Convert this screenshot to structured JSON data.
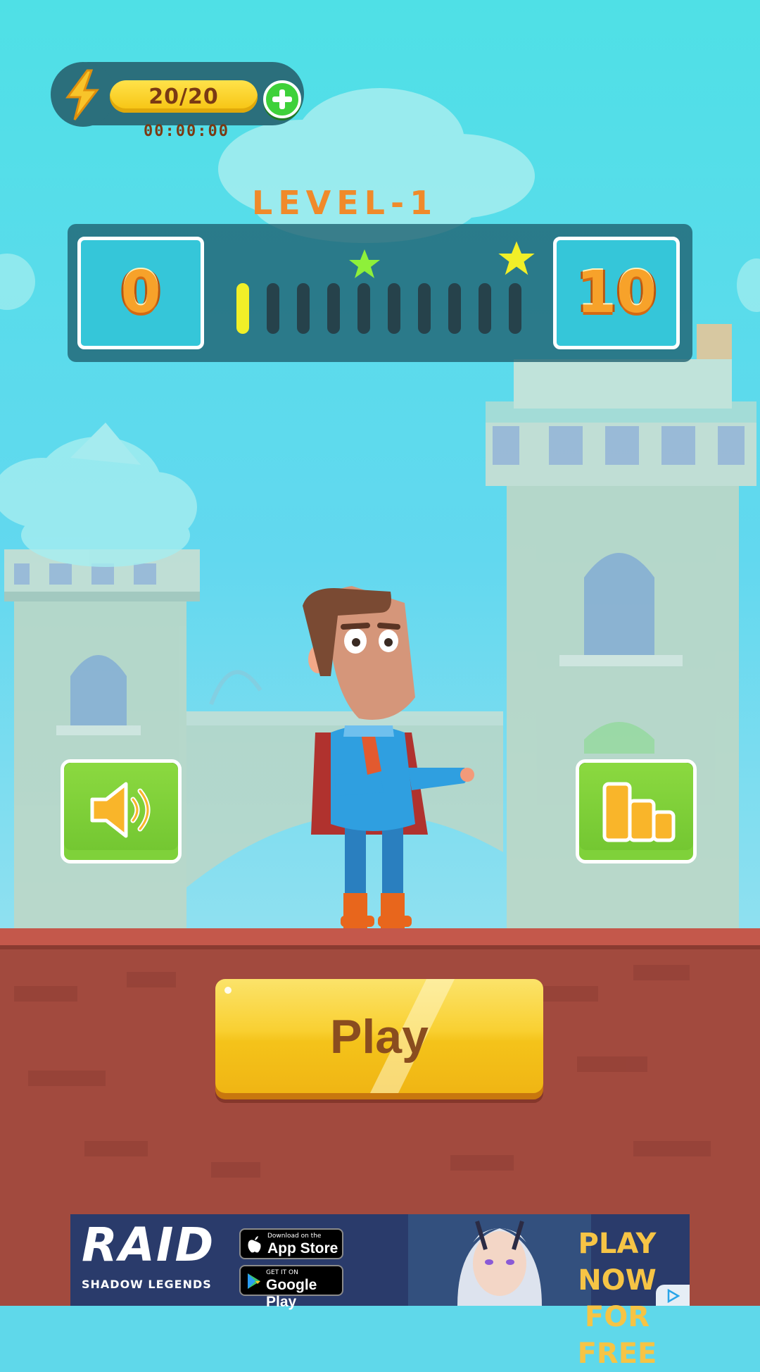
{
  "energy": {
    "value": "20/20",
    "timer": "00:00:00"
  },
  "level": {
    "title": "LEVEL-1",
    "current_level": "0",
    "next_level": "10",
    "progress_segments_total": 10,
    "progress_segments_filled": 1
  },
  "buttons": {
    "play_label": "Play"
  },
  "ad": {
    "brand": "RAID",
    "brand_sub": "SHADOW LEGENDS",
    "app_store_small": "Download on the",
    "app_store_big": "App Store",
    "google_play_small": "GET IT ON",
    "google_play_big": "Google Play",
    "cta_line1": "PLAY NOW",
    "cta_line2": "FOR FREE"
  },
  "colors": {
    "sky": "#5fd8ea",
    "brick": "#a24a3e",
    "play_button": "#f9d032",
    "side_button": "#7fd13a",
    "level_title": "#f08a2a"
  },
  "icons": [
    "lightning-bolt-icon",
    "plus-icon",
    "star-icon",
    "speaker-icon",
    "bar-chart-icon",
    "ad-info-icon"
  ]
}
